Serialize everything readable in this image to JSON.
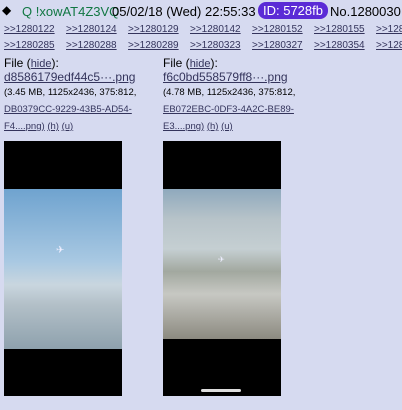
{
  "header": {
    "trip": "Q !xowAT4Z3VQ",
    "date": "05/02/18 (Wed) 22:55:33",
    "id": "ID: 5728fb",
    "post_no": "No.1280030"
  },
  "backlinks": [
    [
      ">>1280122",
      ">>1280124",
      ">>1280129",
      ">>1280142",
      ">>1280152",
      ">>1280155",
      ">>128"
    ],
    [
      ">>1280285",
      ">>1280288",
      ">>1280289",
      ">>1280323",
      ">>1280327",
      ">>1280354",
      ">>128"
    ]
  ],
  "files": [
    {
      "label": "File",
      "hide": "hide",
      "name": "d8586179edf44c5···.png",
      "meta1": "(3.45 MB, 1125x2436, 375:812,",
      "meta2": "DB0379CC-9229-43B5-AD54-",
      "meta3a": "F4....png)",
      "h": "(h)",
      "u": "(u)"
    },
    {
      "label": "File",
      "hide": "hide",
      "name": "f6c0bd558579ff8···.png",
      "meta1": "(4.78 MB, 1125x2436, 375:812,",
      "meta2": "EB072EBC-0DF3-4A2C-BE89-",
      "meta3a": "E3....png)",
      "h": "(h)",
      "u": "(u)"
    }
  ]
}
